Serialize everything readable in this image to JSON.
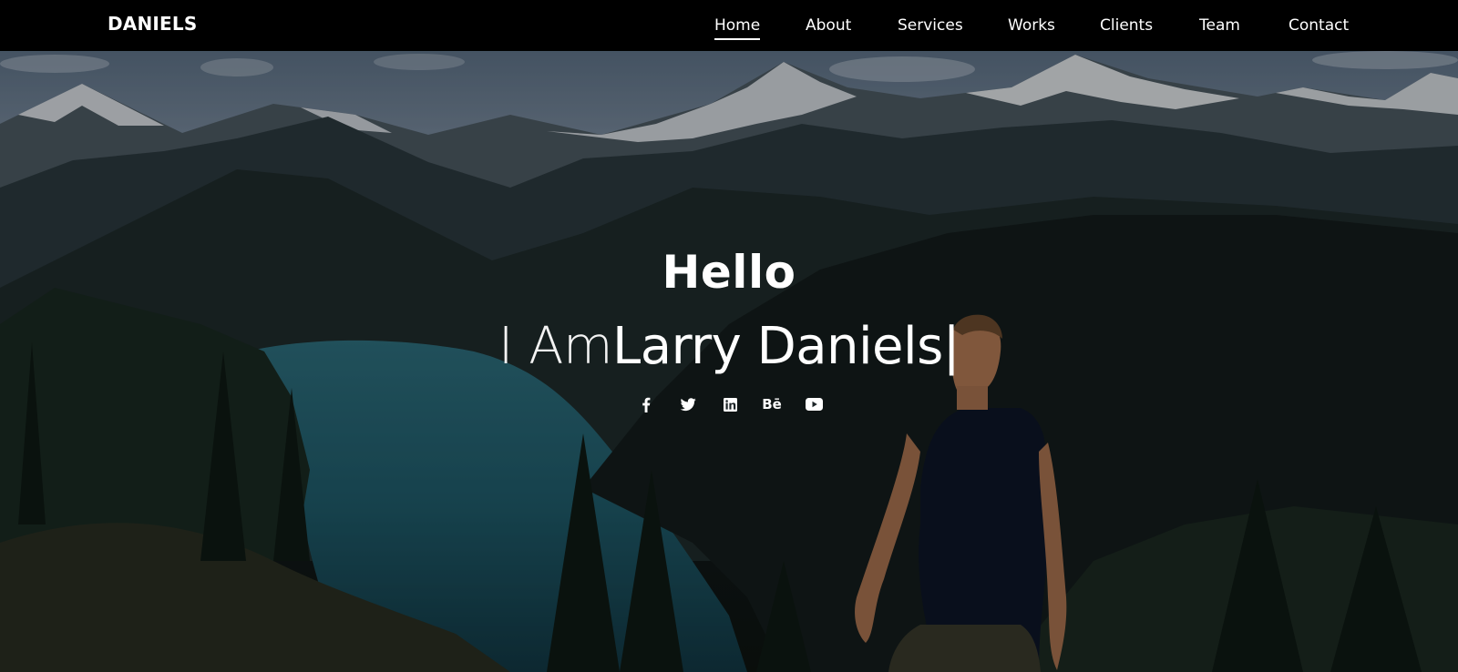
{
  "header": {
    "logo": "DANIELS",
    "nav": [
      {
        "label": "Home",
        "active": true
      },
      {
        "label": "About"
      },
      {
        "label": "Services"
      },
      {
        "label": "Works"
      },
      {
        "label": "Clients"
      },
      {
        "label": "Team"
      },
      {
        "label": "Contact"
      }
    ]
  },
  "hero": {
    "greeting": "Hello",
    "intro_prefix": "I Am",
    "name": "Larry Daniels",
    "cursor": "|",
    "socials": [
      {
        "icon": "facebook-icon"
      },
      {
        "icon": "twitter-icon"
      },
      {
        "icon": "linkedin-icon"
      },
      {
        "icon": "behance-icon",
        "text": "Bē"
      },
      {
        "icon": "youtube-icon"
      }
    ]
  },
  "colors": {
    "header_bg": "#000000",
    "text": "#ffffff"
  }
}
